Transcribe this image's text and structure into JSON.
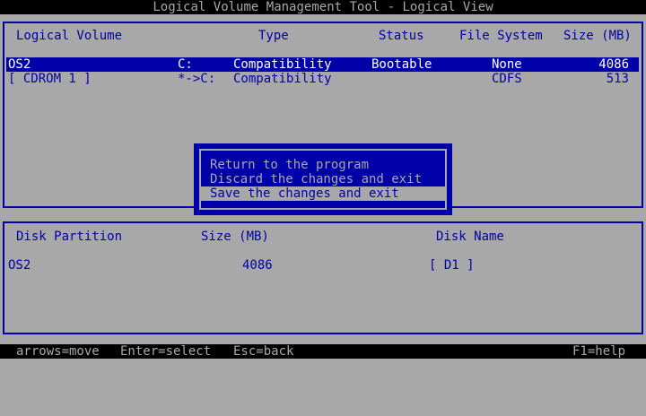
{
  "window": {
    "title": "Logical Volume Management Tool - Logical View"
  },
  "logical_volumes": {
    "headers": {
      "volume": "Logical Volume",
      "type": "Type",
      "status": "Status",
      "fs": "File System",
      "size": "Size (MB)"
    },
    "rows": [
      {
        "name": "OS2",
        "drive": "C:",
        "type": "Compatibility",
        "status": "Bootable",
        "fs": "None",
        "size": "4086",
        "selected": true
      },
      {
        "name": "[ CDROM 1 ]",
        "drive": "*->C:",
        "type": "Compatibility",
        "status": "",
        "fs": "CDFS",
        "size": "513",
        "selected": false
      }
    ]
  },
  "dialog": {
    "items": [
      {
        "label": "Return to the program",
        "selected": false
      },
      {
        "label": "Discard the changes and exit",
        "selected": false
      },
      {
        "label": "Save the changes and exit",
        "selected": true
      }
    ]
  },
  "disk_partitions": {
    "headers": {
      "partition": "Disk Partition",
      "size": "Size (MB)",
      "disk": "Disk Name"
    },
    "rows": [
      {
        "partition": "OS2",
        "size": "4086",
        "disk": "[ D1 ]"
      }
    ]
  },
  "statusbar": {
    "move": "arrows=move",
    "select": "Enter=select",
    "back": "Esc=back",
    "help": "F1=help"
  },
  "colors": {
    "blue": "#0000a8",
    "gray": "#a8a8a8",
    "black": "#000000",
    "white": "#ffffff"
  }
}
